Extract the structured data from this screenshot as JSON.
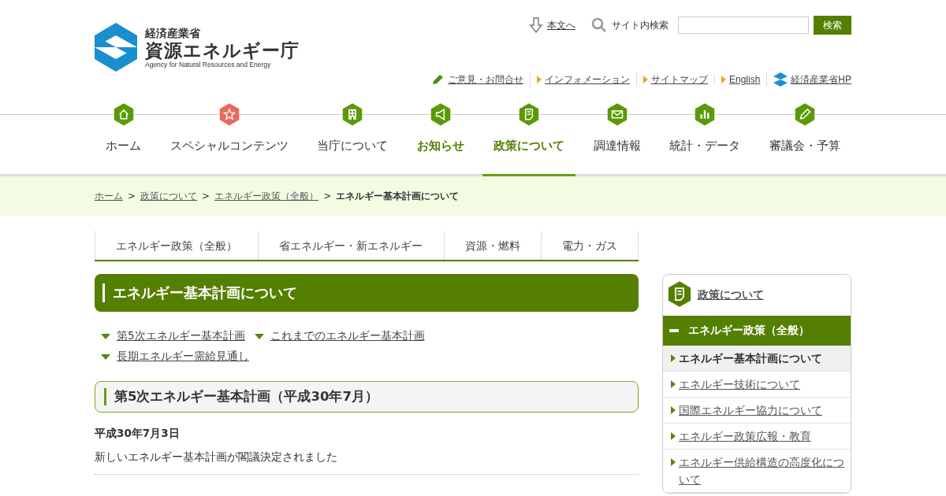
{
  "logo": {
    "ministry": "経済産業省",
    "agency": "資源エネルギー庁",
    "english": "Agency for Natural Resources and Energy"
  },
  "utility": {
    "skip_link": "本文へ",
    "search_label": "サイト内検索",
    "search_button": "検索"
  },
  "header_links": [
    {
      "label": "ご意見・お問合せ",
      "kind": "pencil"
    },
    {
      "label": "インフォメーション",
      "kind": "arrow"
    },
    {
      "label": "サイトマップ",
      "kind": "arrow"
    },
    {
      "label": "English",
      "kind": "arrow"
    },
    {
      "label": "経済産業省HP",
      "kind": "logo"
    }
  ],
  "nav": [
    {
      "label": "ホーム",
      "color": "#5a9a08",
      "accent": false,
      "selected": false
    },
    {
      "label": "スペシャルコンテンツ",
      "color": "#e86a5c",
      "accent": false,
      "selected": false
    },
    {
      "label": "当庁について",
      "color": "#5a9a08",
      "accent": false,
      "selected": false
    },
    {
      "label": "お知らせ",
      "color": "#5a9a08",
      "accent": true,
      "selected": false
    },
    {
      "label": "政策について",
      "color": "#5a9a08",
      "accent": true,
      "selected": true
    },
    {
      "label": "調達情報",
      "color": "#5a9a08",
      "accent": false,
      "selected": false
    },
    {
      "label": "統計・データ",
      "color": "#5a9a08",
      "accent": false,
      "selected": false
    },
    {
      "label": "審議会・予算",
      "color": "#5a9a08",
      "accent": false,
      "selected": false
    }
  ],
  "breadcrumb": [
    {
      "label": "ホーム",
      "current": false
    },
    {
      "separator": ">",
      "label": "政策について",
      "current": false
    },
    {
      "separator": ">",
      "label": "エネルギー政策（全般）",
      "current": false
    },
    {
      "separator": ">",
      "label": "エネルギー基本計画について",
      "current": true
    }
  ],
  "sub_tabs": [
    "エネルギー政策（全般）",
    "省エネルギー・新エネルギー",
    "資源・燃料",
    "電力・ガス"
  ],
  "page_title": "エネルギー基本計画について",
  "anchor_links": [
    "第5次エネルギー基本計画",
    "これまでのエネルギー基本計画",
    "長期エネルギー需給見通し"
  ],
  "section_heading": "第5次エネルギー基本計画（平成30年7月）",
  "date": "平成30年7月3日",
  "body": "新しいエネルギー基本計画が閣議決定されました",
  "sidebar": {
    "title": "政策について",
    "category": "エネルギー政策（全般）",
    "items": [
      {
        "label": "エネルギー基本計画について",
        "selected": true
      },
      {
        "label": "エネルギー技術について",
        "selected": false
      },
      {
        "label": "国際エネルギー協力について",
        "selected": false
      },
      {
        "label": "エネルギー政策広報・教育",
        "selected": false
      },
      {
        "label": "エネルギー供給構造の高度化について",
        "selected": false
      }
    ]
  }
}
